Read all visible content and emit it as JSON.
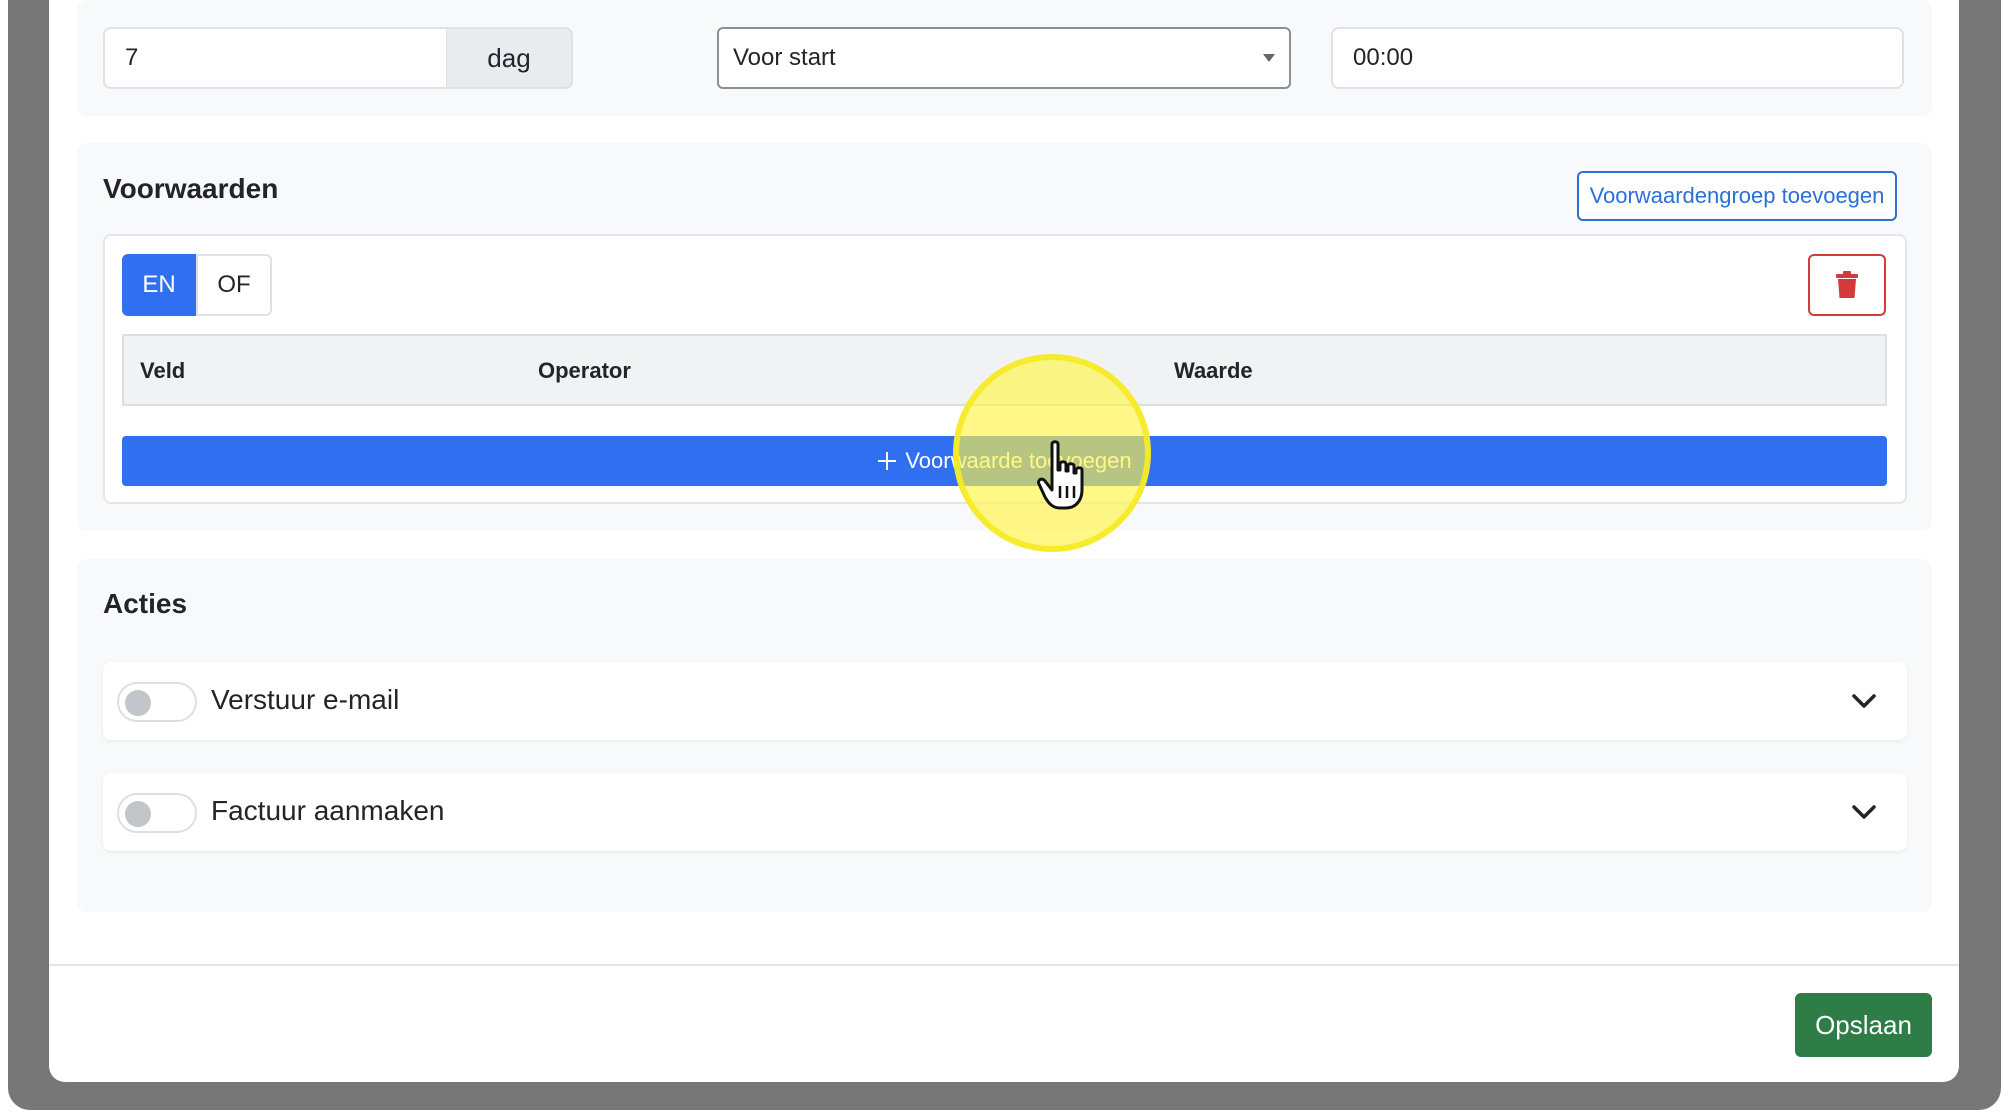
{
  "timing": {
    "amount_value": "7",
    "unit_addon": "dag",
    "relative_select_value": "Voor start",
    "time_value": "00:00"
  },
  "conditions": {
    "title": "Voorwaarden",
    "add_group_label": "Voorwaardengroep toevoegen",
    "logic_and": "EN",
    "logic_or": "OF",
    "active_logic": "EN",
    "columns": [
      "Veld",
      "Operator",
      "Waarde"
    ],
    "add_condition_label": "Voorwaarde toevoegen"
  },
  "actions": {
    "title": "Acties",
    "items": [
      {
        "label": "Verstuur e-mail",
        "enabled": false
      },
      {
        "label": "Factuur aanmaken",
        "enabled": false
      }
    ]
  },
  "footer": {
    "save_label": "Opslaan"
  },
  "colors": {
    "primary": "#2f6ff0",
    "success": "#2e7d46",
    "danger": "#d33a3a",
    "highlight": "#fff546"
  }
}
